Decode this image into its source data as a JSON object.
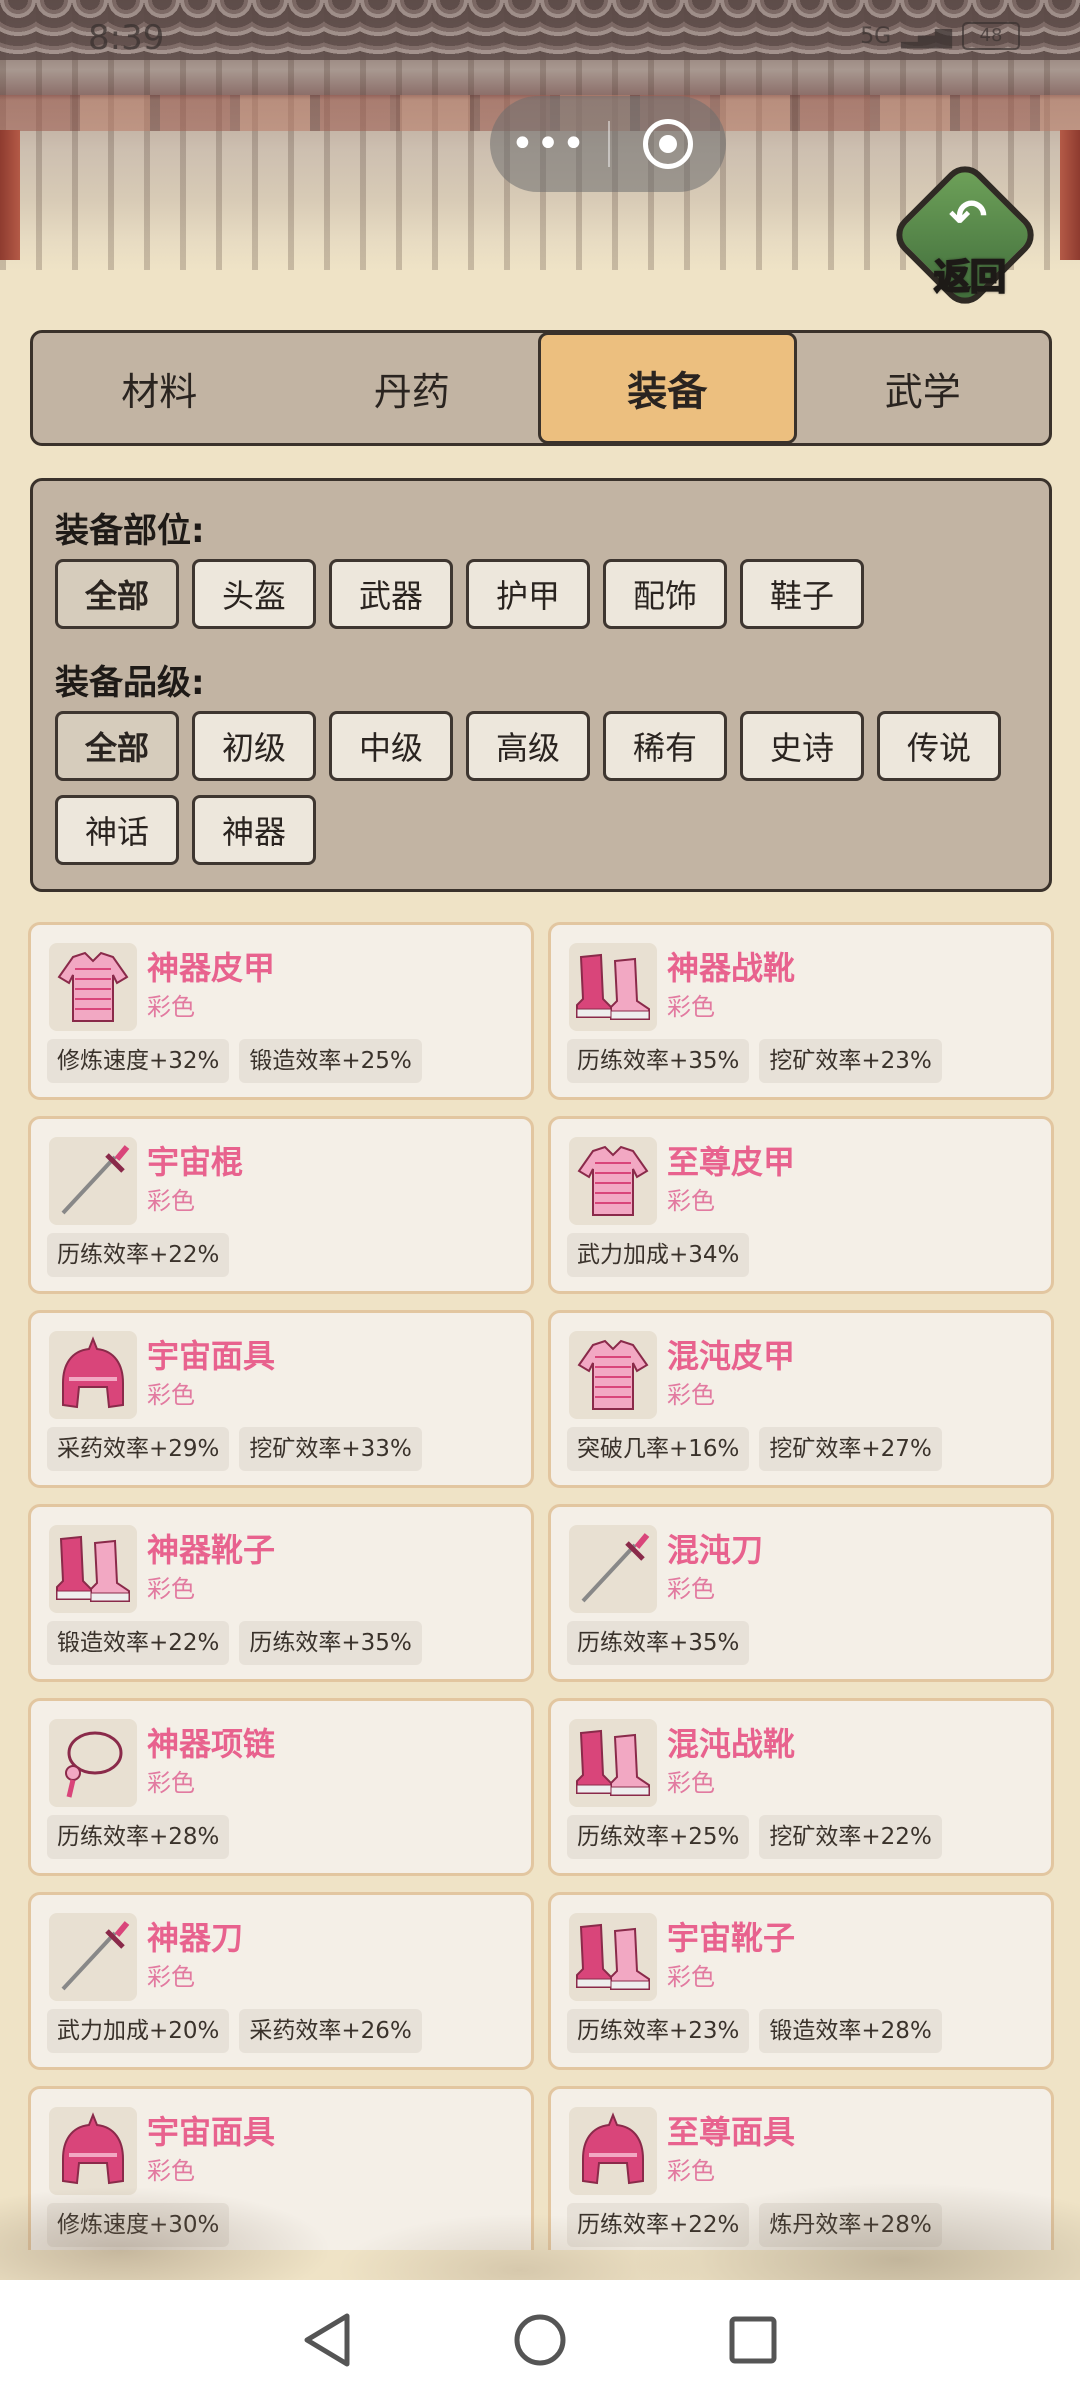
{
  "status_bar": {
    "time": "8:39",
    "battery": "48",
    "network": "5G"
  },
  "capsule": {
    "more_glyph": "•••",
    "more_icon": "more-dots-icon",
    "close_icon": "target-close-icon"
  },
  "header": {
    "back_label": "返回",
    "back_icon": "return-arrow-icon"
  },
  "tabs": [
    {
      "label": "材料",
      "active": false
    },
    {
      "label": "丹药",
      "active": false
    },
    {
      "label": "装备",
      "active": true
    },
    {
      "label": "武学",
      "active": false
    }
  ],
  "filters": {
    "slot_title": "装备部位:",
    "slot_options": [
      "全部",
      "头盔",
      "武器",
      "护甲",
      "配饰",
      "鞋子"
    ],
    "slot_selected": "全部",
    "grade_title": "装备品级:",
    "grade_options": [
      "全部",
      "初级",
      "中级",
      "高级",
      "稀有",
      "史诗",
      "传说",
      "神话",
      "神器"
    ],
    "grade_selected": "全部"
  },
  "items": [
    {
      "name": "神器皮甲",
      "rarity": "彩色",
      "icon": "armor-icon",
      "stats": [
        "修炼速度+32%",
        "锻造效率+25%"
      ]
    },
    {
      "name": "神器战靴",
      "rarity": "彩色",
      "icon": "boots-icon",
      "stats": [
        "历练效率+35%",
        "挖矿效率+23%"
      ]
    },
    {
      "name": "宇宙棍",
      "rarity": "彩色",
      "icon": "sword-icon",
      "stats": [
        "历练效率+22%"
      ]
    },
    {
      "name": "至尊皮甲",
      "rarity": "彩色",
      "icon": "armor-icon",
      "stats": [
        "武力加成+34%"
      ]
    },
    {
      "name": "宇宙面具",
      "rarity": "彩色",
      "icon": "helmet-icon",
      "stats": [
        "采药效率+29%",
        "挖矿效率+33%"
      ]
    },
    {
      "name": "混沌皮甲",
      "rarity": "彩色",
      "icon": "armor-icon",
      "stats": [
        "突破几率+16%",
        "挖矿效率+27%"
      ]
    },
    {
      "name": "神器靴子",
      "rarity": "彩色",
      "icon": "boots-icon",
      "stats": [
        "锻造效率+22%",
        "历练效率+35%"
      ]
    },
    {
      "name": "混沌刀",
      "rarity": "彩色",
      "icon": "sword-icon",
      "stats": [
        "历练效率+35%"
      ]
    },
    {
      "name": "神器项链",
      "rarity": "彩色",
      "icon": "necklace-icon",
      "stats": [
        "历练效率+28%"
      ]
    },
    {
      "name": "混沌战靴",
      "rarity": "彩色",
      "icon": "boots-icon",
      "stats": [
        "历练效率+25%",
        "挖矿效率+22%"
      ]
    },
    {
      "name": "神器刀",
      "rarity": "彩色",
      "icon": "sword-icon",
      "stats": [
        "武力加成+20%",
        "采药效率+26%"
      ]
    },
    {
      "name": "宇宙靴子",
      "rarity": "彩色",
      "icon": "boots-icon",
      "stats": [
        "历练效率+23%",
        "锻造效率+28%"
      ]
    },
    {
      "name": "宇宙面具",
      "rarity": "彩色",
      "icon": "helmet-icon",
      "stats": [
        "修炼速度+30%"
      ]
    },
    {
      "name": "至尊面具",
      "rarity": "彩色",
      "icon": "helmet-icon",
      "stats": [
        "历练效率+22%",
        "炼丹效率+28%"
      ]
    }
  ],
  "colors": {
    "item_name": "#e8628e",
    "tab_active": "#ecbf7f",
    "panel": "#c2b4a3",
    "background": "#efe3c6"
  },
  "navbar": {
    "back_icon": "nav-back-icon",
    "home_icon": "nav-home-icon",
    "recents_icon": "nav-recents-icon"
  }
}
